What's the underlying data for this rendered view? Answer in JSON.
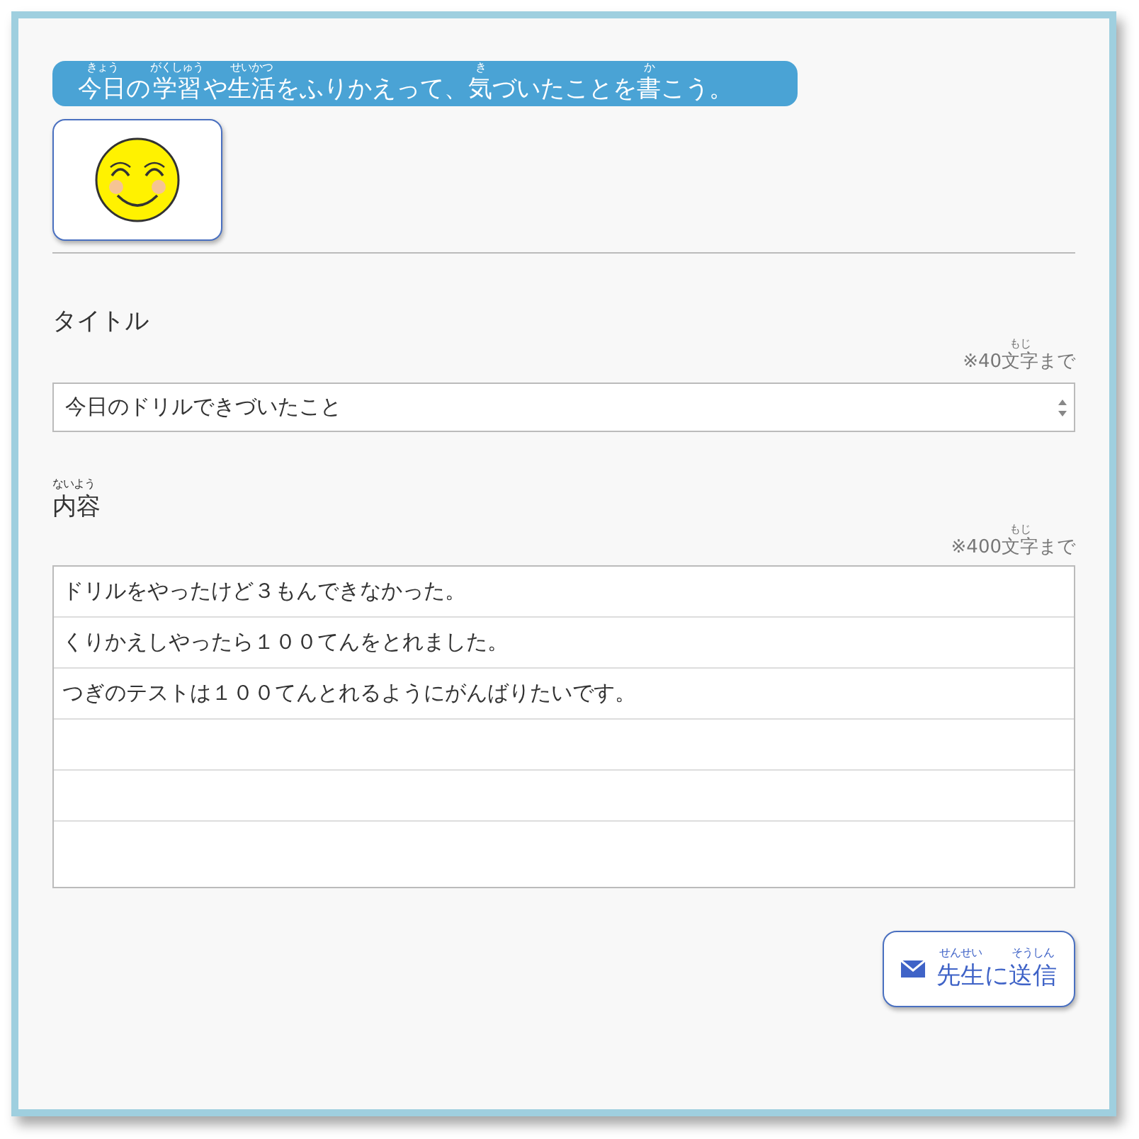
{
  "prompt": [
    {
      "base": "今日",
      "ruby": "きょう"
    },
    {
      "base": "の"
    },
    {
      "base": "学習",
      "ruby": "がくしゅう"
    },
    {
      "base": "や"
    },
    {
      "base": "生活",
      "ruby": "せいかつ"
    },
    {
      "base": "をふりかえって、"
    },
    {
      "base": "気",
      "ruby": "き"
    },
    {
      "base": "づいたことを"
    },
    {
      "base": "書",
      "ruby": "か"
    },
    {
      "base": "こう。"
    }
  ],
  "title_label": [
    {
      "base": "タイトル"
    }
  ],
  "title_limit": [
    {
      "base": "※40"
    },
    {
      "base": "文字",
      "ruby": "もじ"
    },
    {
      "base": "まで"
    }
  ],
  "title_value": "今日のドリルできづいたこと",
  "content_label": [
    {
      "base": "内容",
      "ruby": "ないよう"
    }
  ],
  "content_limit": [
    {
      "base": "※400"
    },
    {
      "base": "文字",
      "ruby": "もじ"
    },
    {
      "base": "まで"
    }
  ],
  "content_lines": [
    "ドリルをやったけど３もんできなかった。",
    "くりかえしやったら１００てんをとれました。",
    "つぎのテストは１００てんとれるようにがんばりたいです。"
  ],
  "send_button": [
    {
      "base": "先生",
      "ruby": "せんせい"
    },
    {
      "base": "に"
    },
    {
      "base": "送信",
      "ruby": "そうしん"
    }
  ]
}
